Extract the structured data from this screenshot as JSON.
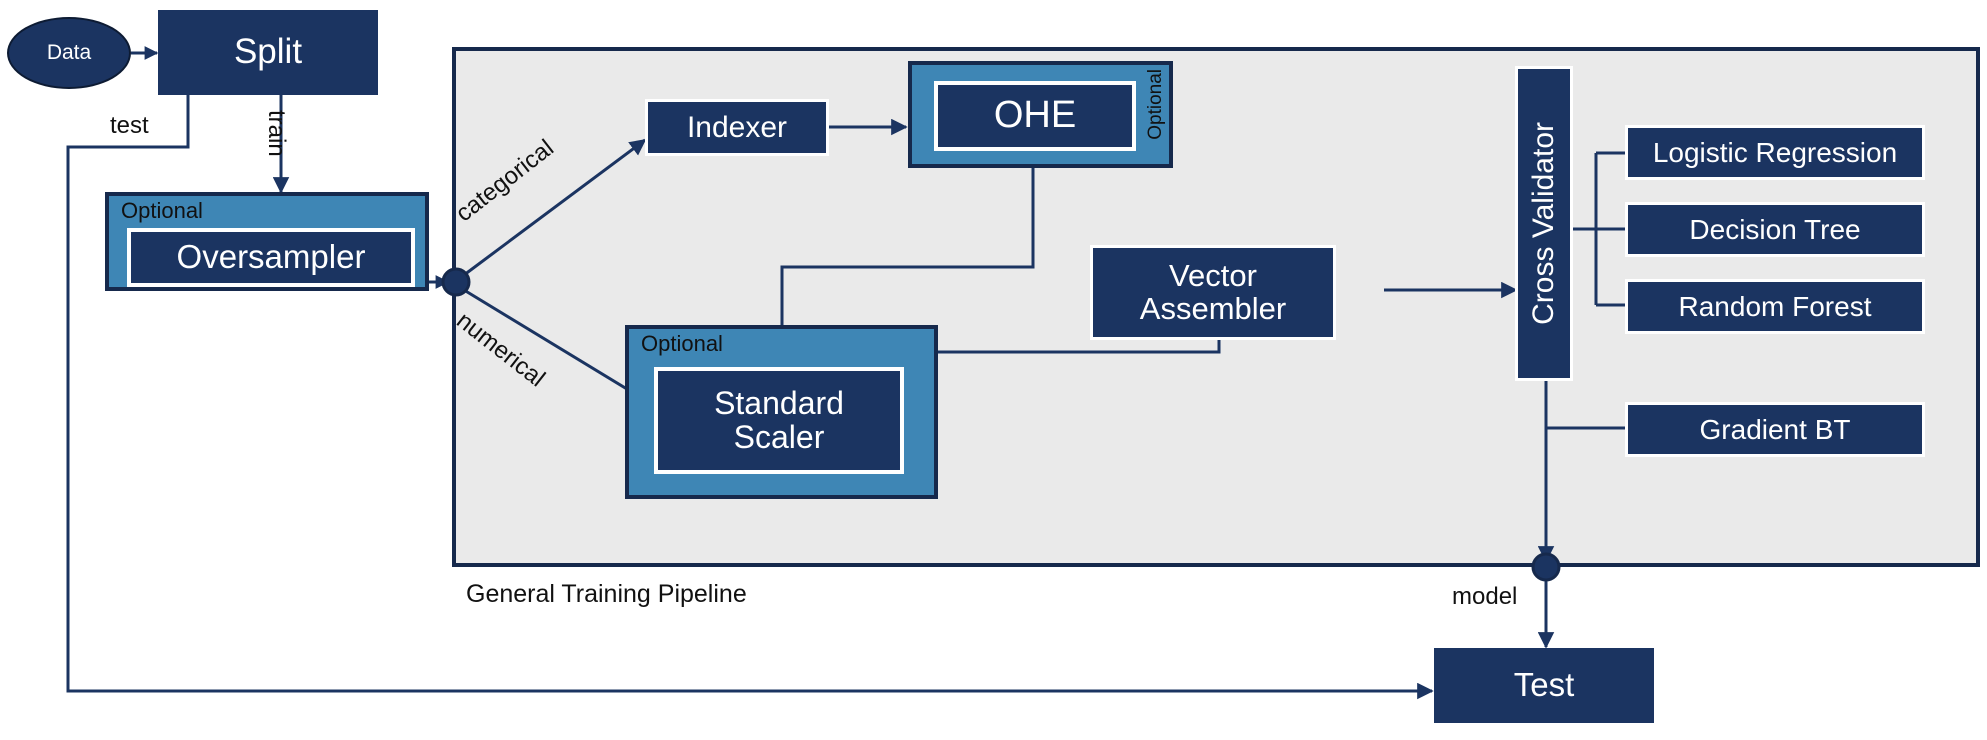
{
  "diagram": {
    "title": "General Training Pipeline",
    "pipeline_caption": "General Training Pipeline"
  },
  "colors": {
    "dark_navy": "#1b3461",
    "darker_navy": "#16294c",
    "mid_blue": "#3e86b5",
    "pipeline_bg": "#eaeaea",
    "white": "#ffffff",
    "text_black": "#111111"
  },
  "nodes": {
    "data": {
      "label": "Data",
      "shape": "ellipse"
    },
    "split": {
      "label": "Split",
      "shape": "rect"
    },
    "oversampler": {
      "label": "Oversampler",
      "optional_label": "Optional"
    },
    "indexer": {
      "label": "Indexer"
    },
    "ohe": {
      "label": "OHE",
      "optional_label": "Optional"
    },
    "standard_scaler": {
      "label": "Standard\nScaler",
      "line1": "Standard",
      "line2": "Scaler",
      "optional_label": "Optional"
    },
    "vector_assembler": {
      "label": "Vector Assembler",
      "line1": "Vector",
      "line2": "Assembler"
    },
    "cross_validator": {
      "label": "Cross Validator"
    },
    "test": {
      "label": "Test"
    }
  },
  "models": [
    {
      "label": "Logistic Regression"
    },
    {
      "label": "Decision Tree"
    },
    {
      "label": "Random Forest"
    },
    {
      "label": "Gradient BT"
    }
  ],
  "edge_labels": {
    "test": "test",
    "train": "train",
    "categorical": "categorical",
    "numerical": "numerical",
    "model": "model"
  }
}
